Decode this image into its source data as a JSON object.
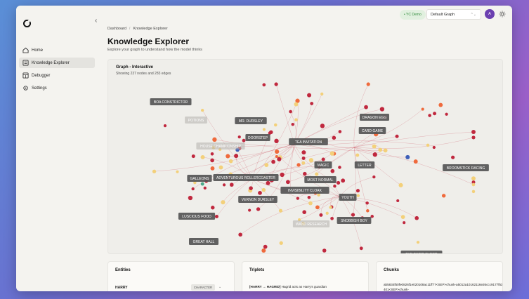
{
  "window": {
    "sidebar": {
      "items": [
        {
          "label": "Home",
          "icon": "home-icon",
          "active": false
        },
        {
          "label": "Knowledge Explorer",
          "icon": "graph-icon",
          "active": true
        },
        {
          "label": "Debugger",
          "icon": "debug-icon",
          "active": false
        },
        {
          "label": "Settings",
          "icon": "gear-icon",
          "active": false
        }
      ]
    },
    "topbar": {
      "badge": "• YC Demo",
      "graph_select": "Default Graph",
      "avatar_letter": "A"
    },
    "header": {
      "breadcrumb": [
        "Dashboard",
        "Knowledge Explorer"
      ],
      "breadcrumb_sep": "/",
      "title": "Knowledge Explorer",
      "subtitle": "Explore your graph to understand how the model thinks"
    },
    "graph": {
      "title": "Graph - Interactive",
      "count": "Showing 237 nodes and 283 edges",
      "labels": [
        "BOA CONSTRICTOR",
        "POTIONS",
        "MR. DURSLEY",
        "DOORSTEP",
        "HOUSE CHAMPIONSHIP",
        "TEA INVITATION",
        "DRAGON EGG",
        "CARD GAME",
        "GALLEONS",
        "ADVENTUROUS ROLLERCOASTER",
        "MAGIC",
        "LETTER",
        "MOST NORMAL",
        "VERNON DURSLEY",
        "INVISIBILITY CLOAK",
        "YOUTH",
        "BROOMSTICK RACING",
        "LUSCIOUS FOOD",
        "SNOBBISH BOY",
        "WAND RESEARCH",
        "GREAT HALL",
        "THE THIRD FLOOR"
      ]
    },
    "entities": {
      "title": "Entities",
      "first": {
        "name": "HARRY",
        "tag": "CHARACTER"
      }
    },
    "triplets": {
      "title": "Triplets",
      "first_head": "[HARRY → HAGRID]",
      "first_text": "Hagrid acts as Harry's guardian"
    },
    "chunks": {
      "title": "Chunks",
      "first": "ab5834f50fe0826f1e020108ac11ff77<SEP>chunk-a5012a10162116e26ccc9177f5388401<SEP>chunk-"
    }
  },
  "colors": {
    "accent_green": "#2f8a3a",
    "avatar": "#6b3fb0",
    "node_red": "#c0283e",
    "node_orange": "#ef6a3c",
    "node_yellow": "#f3d07a",
    "node_blue": "#3f5fb8",
    "node_teal": "#4aaa8a",
    "edge": "#c9404f"
  }
}
